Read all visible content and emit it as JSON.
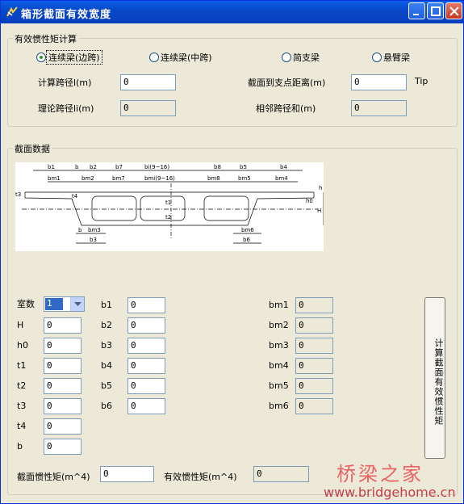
{
  "window": {
    "title": "箱形截面有效宽度"
  },
  "group1": {
    "label": "有效惯性矩计算",
    "radios": [
      {
        "label": "连续梁(边跨)",
        "selected": true
      },
      {
        "label": "连续梁(中跨)",
        "selected": false
      },
      {
        "label": "简支梁",
        "selected": false
      },
      {
        "label": "悬臂梁",
        "selected": false
      }
    ],
    "span_label": "计算跨径l(m)",
    "span_value": "0",
    "support_dist_label": "截面到支点距离(m)",
    "support_dist_value": "0",
    "tip_label": "Tip",
    "theory_span_label": "理论跨径li(m)",
    "theory_span_value": "0",
    "adjacent_span_label": "相邻跨径和(m)",
    "adjacent_span_value": "0"
  },
  "group2": {
    "label": "截面数据",
    "diagram": {
      "top_dims": [
        "b1",
        "b",
        "b2",
        "b7",
        "bi(9~16)",
        "b8",
        "b5",
        "b4"
      ],
      "mid_dims": [
        "bm1",
        "bm2",
        "bm7",
        "bmi(9~16)",
        "bm8",
        "bm5",
        "bm4"
      ],
      "side_labels": [
        "t3",
        "t1",
        "t2",
        "t4",
        "h0",
        "H",
        "h"
      ],
      "bottom_dims": [
        "b",
        "bm3",
        "b3",
        "bm6",
        "b6"
      ]
    },
    "fields": {
      "cells_label": "室数",
      "cells_value": "1",
      "H_label": "H",
      "H_value": "0",
      "h0_label": "h0",
      "h0_value": "0",
      "t1_label": "t1",
      "t1_value": "0",
      "t2_label": "t2",
      "t2_value": "0",
      "t3_label": "t3",
      "t3_value": "0",
      "t4_label": "t4",
      "t4_value": "0",
      "b_label": "b",
      "b_value": "0",
      "b1_label": "b1",
      "b1_value": "0",
      "b2_label": "b2",
      "b2_value": "0",
      "b3_label": "b3",
      "b3_value": "0",
      "b4_label": "b4",
      "b4_value": "0",
      "b5_label": "b5",
      "b5_value": "0",
      "b6_label": "b6",
      "b6_value": "0",
      "bm1_label": "bm1",
      "bm1_value": "0",
      "bm2_label": "bm2",
      "bm2_value": "0",
      "bm3_label": "bm3",
      "bm3_value": "0",
      "bm4_label": "bm4",
      "bm4_value": "0",
      "bm5_label": "bm5",
      "bm5_value": "0",
      "bm6_label": "bm6",
      "bm6_value": "0"
    },
    "calc_button": "计算截面有效惯性矩",
    "inertia_label": "截面惯性矩(m^4)",
    "inertia_value": "0",
    "eff_inertia_label": "有效惯性矩(m^4)",
    "eff_inertia_value": "0"
  },
  "watermark": {
    "cn": "桥梁之家",
    "en": "www.bridgehome.cn"
  },
  "colors": {
    "titlebar": "#0a5fe8",
    "face": "#ece9d8",
    "watermark": "#e86464"
  }
}
